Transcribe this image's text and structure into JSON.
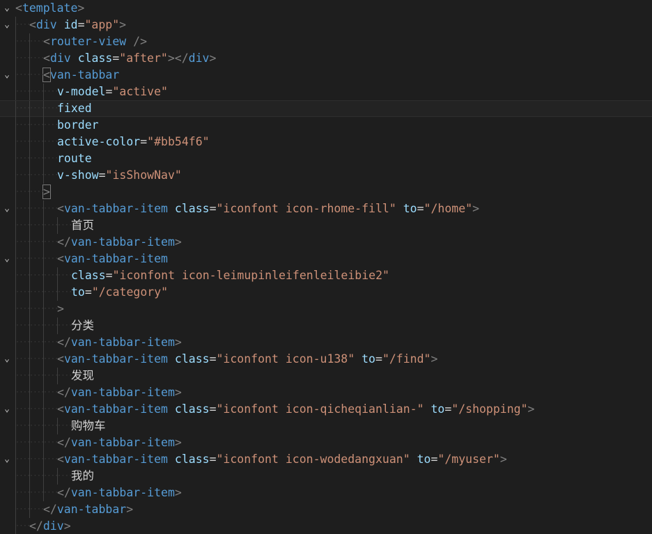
{
  "editor": {
    "lines": [
      {
        "n": 1,
        "fold": "open",
        "indent": 0,
        "tokens": [
          {
            "c": "punc",
            "t": "<"
          },
          {
            "c": "tag",
            "t": "template"
          },
          {
            "c": "punc",
            "t": ">"
          }
        ]
      },
      {
        "n": 2,
        "fold": "open",
        "indent": 1,
        "tokens": [
          {
            "c": "punc",
            "t": "<"
          },
          {
            "c": "tag",
            "t": "div"
          },
          {
            "c": "eq",
            "t": " "
          },
          {
            "c": "attr",
            "t": "id"
          },
          {
            "c": "eq",
            "t": "="
          },
          {
            "c": "str",
            "t": "\"app\""
          },
          {
            "c": "punc",
            "t": ">"
          }
        ]
      },
      {
        "n": 3,
        "fold": "",
        "indent": 2,
        "tokens": [
          {
            "c": "punc",
            "t": "<"
          },
          {
            "c": "tag",
            "t": "router-view"
          },
          {
            "c": "eq",
            "t": " "
          },
          {
            "c": "punc",
            "t": "/>"
          }
        ]
      },
      {
        "n": 4,
        "fold": "",
        "indent": 2,
        "tokens": [
          {
            "c": "punc",
            "t": "<"
          },
          {
            "c": "tag",
            "t": "div"
          },
          {
            "c": "eq",
            "t": " "
          },
          {
            "c": "attr",
            "t": "class"
          },
          {
            "c": "eq",
            "t": "="
          },
          {
            "c": "str",
            "t": "\"after\""
          },
          {
            "c": "punc",
            "t": "></"
          },
          {
            "c": "tag",
            "t": "div"
          },
          {
            "c": "punc",
            "t": ">"
          }
        ]
      },
      {
        "n": 5,
        "fold": "open",
        "indent": 2,
        "tokens": [
          {
            "c": "punc",
            "t": "<",
            "box": true
          },
          {
            "c": "tag",
            "t": "van-tabbar"
          }
        ]
      },
      {
        "n": 6,
        "fold": "",
        "indent": 3,
        "tokens": [
          {
            "c": "attr",
            "t": "v-model"
          },
          {
            "c": "eq",
            "t": "="
          },
          {
            "c": "str",
            "t": "\"active\""
          }
        ]
      },
      {
        "n": 7,
        "fold": "",
        "indent": 3,
        "current": true,
        "tokens": [
          {
            "c": "attr",
            "t": "fixed"
          }
        ]
      },
      {
        "n": 8,
        "fold": "",
        "indent": 3,
        "tokens": [
          {
            "c": "attr",
            "t": "border"
          }
        ]
      },
      {
        "n": 9,
        "fold": "",
        "indent": 3,
        "tokens": [
          {
            "c": "attr",
            "t": "active-color"
          },
          {
            "c": "eq",
            "t": "="
          },
          {
            "c": "str",
            "t": "\"#bb54f6\""
          }
        ]
      },
      {
        "n": 10,
        "fold": "",
        "indent": 3,
        "tokens": [
          {
            "c": "attr",
            "t": "route"
          }
        ]
      },
      {
        "n": 11,
        "fold": "",
        "indent": 3,
        "tokens": [
          {
            "c": "attr",
            "t": "v-show"
          },
          {
            "c": "eq",
            "t": "="
          },
          {
            "c": "str",
            "t": "\"isShowNav\""
          }
        ]
      },
      {
        "n": 12,
        "fold": "",
        "indent": 2,
        "tokens": [
          {
            "c": "punc",
            "t": ">",
            "box": true
          }
        ]
      },
      {
        "n": 13,
        "fold": "open",
        "indent": 3,
        "tokens": [
          {
            "c": "punc",
            "t": "<"
          },
          {
            "c": "tag",
            "t": "van-tabbar-item"
          },
          {
            "c": "eq",
            "t": " "
          },
          {
            "c": "attr",
            "t": "class"
          },
          {
            "c": "eq",
            "t": "="
          },
          {
            "c": "str",
            "t": "\"iconfont icon-rhome-fill\""
          },
          {
            "c": "eq",
            "t": " "
          },
          {
            "c": "attr",
            "t": "to"
          },
          {
            "c": "eq",
            "t": "="
          },
          {
            "c": "str",
            "t": "\"/home\""
          },
          {
            "c": "punc",
            "t": ">"
          }
        ]
      },
      {
        "n": 14,
        "fold": "",
        "indent": 4,
        "tokens": [
          {
            "c": "text",
            "t": "首页"
          }
        ]
      },
      {
        "n": 15,
        "fold": "",
        "indent": 3,
        "tokens": [
          {
            "c": "punc",
            "t": "</"
          },
          {
            "c": "tag",
            "t": "van-tabbar-item"
          },
          {
            "c": "punc",
            "t": ">"
          }
        ]
      },
      {
        "n": 16,
        "fold": "open",
        "indent": 3,
        "tokens": [
          {
            "c": "punc",
            "t": "<"
          },
          {
            "c": "tag",
            "t": "van-tabbar-item"
          }
        ]
      },
      {
        "n": 17,
        "fold": "",
        "indent": 4,
        "tokens": [
          {
            "c": "attr",
            "t": "class"
          },
          {
            "c": "eq",
            "t": "="
          },
          {
            "c": "str",
            "t": "\"iconfont icon-leimupinleifenleileibie2\""
          }
        ]
      },
      {
        "n": 18,
        "fold": "",
        "indent": 4,
        "tokens": [
          {
            "c": "attr",
            "t": "to"
          },
          {
            "c": "eq",
            "t": "="
          },
          {
            "c": "str",
            "t": "\"/category\""
          }
        ]
      },
      {
        "n": 19,
        "fold": "",
        "indent": 3,
        "tokens": [
          {
            "c": "punc",
            "t": ">"
          }
        ]
      },
      {
        "n": 20,
        "fold": "",
        "indent": 4,
        "tokens": [
          {
            "c": "text",
            "t": "分类"
          }
        ]
      },
      {
        "n": 21,
        "fold": "",
        "indent": 3,
        "tokens": [
          {
            "c": "punc",
            "t": "</"
          },
          {
            "c": "tag",
            "t": "van-tabbar-item"
          },
          {
            "c": "punc",
            "t": ">"
          }
        ]
      },
      {
        "n": 22,
        "fold": "open",
        "indent": 3,
        "tokens": [
          {
            "c": "punc",
            "t": "<"
          },
          {
            "c": "tag",
            "t": "van-tabbar-item"
          },
          {
            "c": "eq",
            "t": " "
          },
          {
            "c": "attr",
            "t": "class"
          },
          {
            "c": "eq",
            "t": "="
          },
          {
            "c": "str",
            "t": "\"iconfont icon-u138\""
          },
          {
            "c": "eq",
            "t": " "
          },
          {
            "c": "attr",
            "t": "to"
          },
          {
            "c": "eq",
            "t": "="
          },
          {
            "c": "str",
            "t": "\"/find\""
          },
          {
            "c": "punc",
            "t": ">"
          }
        ]
      },
      {
        "n": 23,
        "fold": "",
        "indent": 4,
        "tokens": [
          {
            "c": "text",
            "t": "发现"
          }
        ]
      },
      {
        "n": 24,
        "fold": "",
        "indent": 3,
        "tokens": [
          {
            "c": "punc",
            "t": "</"
          },
          {
            "c": "tag",
            "t": "van-tabbar-item"
          },
          {
            "c": "punc",
            "t": ">"
          }
        ]
      },
      {
        "n": 25,
        "fold": "open",
        "indent": 3,
        "tokens": [
          {
            "c": "punc",
            "t": "<"
          },
          {
            "c": "tag",
            "t": "van-tabbar-item"
          },
          {
            "c": "eq",
            "t": " "
          },
          {
            "c": "attr",
            "t": "class"
          },
          {
            "c": "eq",
            "t": "="
          },
          {
            "c": "str",
            "t": "\"iconfont icon-qicheqianlian-\""
          },
          {
            "c": "eq",
            "t": " "
          },
          {
            "c": "attr",
            "t": "to"
          },
          {
            "c": "eq",
            "t": "="
          },
          {
            "c": "str",
            "t": "\"/shopping\""
          },
          {
            "c": "punc",
            "t": ">"
          }
        ]
      },
      {
        "n": 26,
        "fold": "",
        "indent": 4,
        "tokens": [
          {
            "c": "text",
            "t": "购物车"
          }
        ]
      },
      {
        "n": 27,
        "fold": "",
        "indent": 3,
        "tokens": [
          {
            "c": "punc",
            "t": "</"
          },
          {
            "c": "tag",
            "t": "van-tabbar-item"
          },
          {
            "c": "punc",
            "t": ">"
          }
        ]
      },
      {
        "n": 28,
        "fold": "open",
        "indent": 3,
        "tokens": [
          {
            "c": "punc",
            "t": "<"
          },
          {
            "c": "tag",
            "t": "van-tabbar-item"
          },
          {
            "c": "eq",
            "t": " "
          },
          {
            "c": "attr",
            "t": "class"
          },
          {
            "c": "eq",
            "t": "="
          },
          {
            "c": "str",
            "t": "\"iconfont icon-wodedangxuan\""
          },
          {
            "c": "eq",
            "t": " "
          },
          {
            "c": "attr",
            "t": "to"
          },
          {
            "c": "eq",
            "t": "="
          },
          {
            "c": "str",
            "t": "\"/myuser\""
          },
          {
            "c": "punc",
            "t": ">"
          }
        ]
      },
      {
        "n": 29,
        "fold": "",
        "indent": 4,
        "tokens": [
          {
            "c": "text",
            "t": "我的"
          }
        ]
      },
      {
        "n": 30,
        "fold": "",
        "indent": 3,
        "tokens": [
          {
            "c": "punc",
            "t": "</"
          },
          {
            "c": "tag",
            "t": "van-tabbar-item"
          },
          {
            "c": "punc",
            "t": ">"
          }
        ]
      },
      {
        "n": 31,
        "fold": "",
        "indent": 2,
        "tokens": [
          {
            "c": "punc",
            "t": "</"
          },
          {
            "c": "tag",
            "t": "van-tabbar"
          },
          {
            "c": "punc",
            "t": ">"
          }
        ]
      },
      {
        "n": 32,
        "fold": "",
        "indent": 1,
        "tokens": [
          {
            "c": "punc",
            "t": "</"
          },
          {
            "c": "tag",
            "t": "div"
          },
          {
            "c": "punc",
            "t": ">"
          }
        ]
      }
    ]
  },
  "icons": {
    "fold_open": "chevron-down-icon"
  },
  "colors": {
    "background": "#1e1e1e",
    "tag": "#569cd6",
    "attribute": "#9cdcfe",
    "string": "#ce9178",
    "punctuation": "#808080",
    "text": "#d4d4d4"
  }
}
